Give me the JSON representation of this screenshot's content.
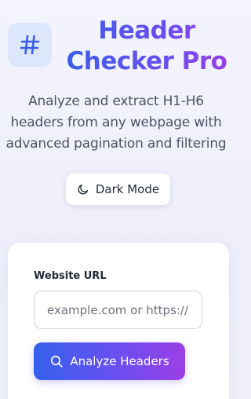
{
  "header": {
    "logo_icon": "hash-icon",
    "title_line1": "Header",
    "title_line2": "Checker Pro",
    "subtitle": "Analyze and extract H1-H6 headers from any webpage with advanced pagination and filtering"
  },
  "theme_toggle": {
    "label": "Dark Mode",
    "icon": "moon-icon"
  },
  "form": {
    "url_label": "Website URL",
    "url_placeholder": "example.com or https://example.com",
    "url_value": "",
    "submit_label": "Analyze Headers",
    "submit_icon": "search-icon"
  },
  "colors": {
    "accent_start": "#3561ea",
    "accent_end": "#9b3fe6",
    "logo_bg": "#dde7fb"
  }
}
